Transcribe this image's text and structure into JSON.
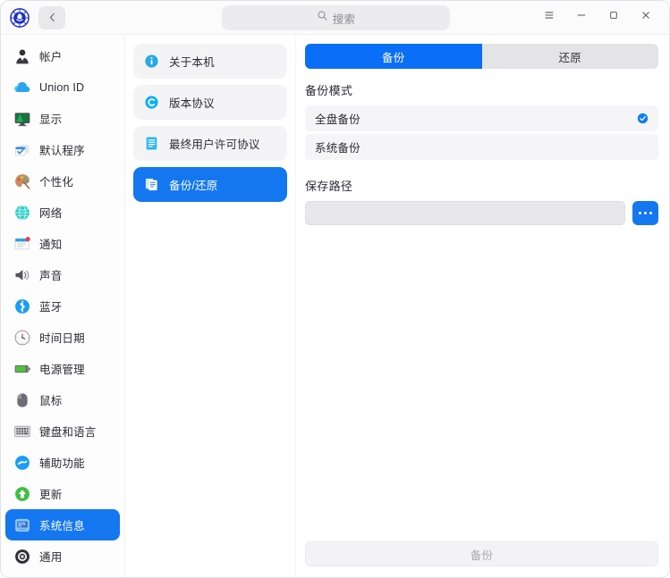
{
  "titlebar": {
    "logo_icon": "deepin-logo-icon",
    "back_icon": "chevron-left-icon",
    "back_label": "返回",
    "search": {
      "icon": "search-icon",
      "placeholder": "搜索",
      "value": ""
    },
    "controls": [
      {
        "name": "menu-button",
        "icon": "hamburger-menu-icon",
        "label": "菜单"
      },
      {
        "name": "minimize-button",
        "icon": "minimize-icon",
        "label": "最小化"
      },
      {
        "name": "maximize-button",
        "icon": "maximize-icon",
        "label": "最大化"
      },
      {
        "name": "close-button",
        "icon": "close-icon",
        "label": "关闭"
      }
    ]
  },
  "sidebar": {
    "items": [
      {
        "label": "帐户",
        "icon": "account-icon",
        "active": false
      },
      {
        "label": "Union ID",
        "icon": "cloud-icon",
        "active": false
      },
      {
        "label": "显示",
        "icon": "display-monitor-icon",
        "active": false
      },
      {
        "label": "默认程序",
        "icon": "default-apps-icon",
        "active": false
      },
      {
        "label": "个性化",
        "icon": "personalization-palette-icon",
        "active": false
      },
      {
        "label": "网络",
        "icon": "network-globe-icon",
        "active": false
      },
      {
        "label": "通知",
        "icon": "notification-icon",
        "active": false
      },
      {
        "label": "声音",
        "icon": "sound-speaker-icon",
        "active": false
      },
      {
        "label": "蓝牙",
        "icon": "bluetooth-icon",
        "active": false
      },
      {
        "label": "时间日期",
        "icon": "clock-icon",
        "active": false
      },
      {
        "label": "电源管理",
        "icon": "battery-power-icon",
        "active": false
      },
      {
        "label": "鼠标",
        "icon": "mouse-icon",
        "active": false
      },
      {
        "label": "键盘和语言",
        "icon": "keyboard-icon",
        "active": false
      },
      {
        "label": "辅助功能",
        "icon": "accessibility-icon",
        "active": false
      },
      {
        "label": "更新",
        "icon": "update-arrow-icon",
        "active": false
      },
      {
        "label": "系统信息",
        "icon": "system-info-icon",
        "active": true
      },
      {
        "label": "通用",
        "icon": "general-settings-icon",
        "active": false
      }
    ]
  },
  "midpanel": {
    "items": [
      {
        "label": "关于本机",
        "icon": "info-circle-icon",
        "active": false
      },
      {
        "label": "版本协议",
        "icon": "copyright-circle-icon",
        "active": false
      },
      {
        "label": "最终用户许可协议",
        "icon": "document-lines-icon",
        "active": false
      },
      {
        "label": "备份/还原",
        "icon": "backup-restore-icon",
        "active": true
      }
    ]
  },
  "content": {
    "tabs": [
      {
        "label": "备份",
        "active": true
      },
      {
        "label": "还原",
        "active": false
      }
    ],
    "backup_mode": {
      "title": "备份模式",
      "options": [
        {
          "label": "全盘备份",
          "selected": true,
          "check_icon": "check-circle-icon"
        },
        {
          "label": "系统备份",
          "selected": false,
          "check_icon": ""
        }
      ]
    },
    "save_path": {
      "title": "保存路径",
      "value": "",
      "placeholder": "",
      "browse_icon": "ellipsis-icon",
      "browse_label": "浏览"
    },
    "action": {
      "label": "备份",
      "disabled": true
    }
  },
  "colors": {
    "accent_blue": "#1477f0",
    "tab_active_blue": "#0b6ef7",
    "row_grey": "#f5f5f7",
    "input_grey": "#e8e8ea",
    "text_primary": "#2b2b33",
    "text_muted": "#a9a9b2"
  }
}
